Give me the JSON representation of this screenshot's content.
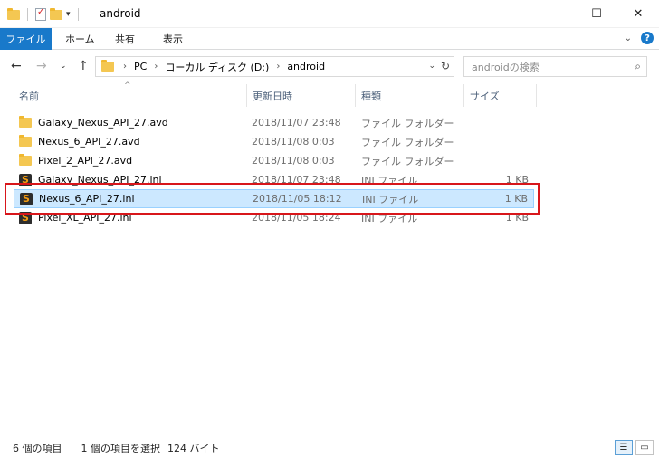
{
  "window": {
    "title": "android",
    "minimize": "—",
    "maximize": "☐",
    "close": "✕"
  },
  "ribbon": {
    "file_tab": "ファイル",
    "tabs": [
      "ホーム",
      "共有",
      "表示"
    ]
  },
  "address": {
    "crumbs": [
      "PC",
      "ローカル ディスク (D:)",
      "android"
    ],
    "search_placeholder": "androidの検索"
  },
  "columns": {
    "name": "名前",
    "date": "更新日時",
    "type": "種類",
    "size": "サイズ"
  },
  "files": [
    {
      "name": "Galaxy_Nexus_API_27.avd",
      "date": "2018/11/07 23:48",
      "type": "ファイル フォルダー",
      "size": "",
      "icon": "folder-icon"
    },
    {
      "name": "Nexus_6_API_27.avd",
      "date": "2018/11/08 0:03",
      "type": "ファイル フォルダー",
      "size": "",
      "icon": "folder-icon"
    },
    {
      "name": "Pixel_2_API_27.avd",
      "date": "2018/11/08 0:03",
      "type": "ファイル フォルダー",
      "size": "",
      "icon": "folder-icon"
    },
    {
      "name": "Galaxy_Nexus_API_27.ini",
      "date": "2018/11/07 23:48",
      "type": "INI ファイル",
      "size": "1 KB",
      "icon": "ini-file-icon"
    },
    {
      "name": "Nexus_6_API_27.ini",
      "date": "2018/11/05 18:12",
      "type": "INI ファイル",
      "size": "1 KB",
      "icon": "ini-file-icon",
      "selected": true
    },
    {
      "name": "Pixel_XL_API_27.ini",
      "date": "2018/11/05 18:24",
      "type": "INI ファイル",
      "size": "1 KB",
      "icon": "ini-file-icon"
    }
  ],
  "status": {
    "item_count": "6 個の項目",
    "selection": "1 個の項目を選択",
    "selection_size": "124 バイト"
  },
  "colors": {
    "accent": "#1979ca",
    "selection_bg": "#cce8ff",
    "highlight_border": "#d8161b"
  }
}
